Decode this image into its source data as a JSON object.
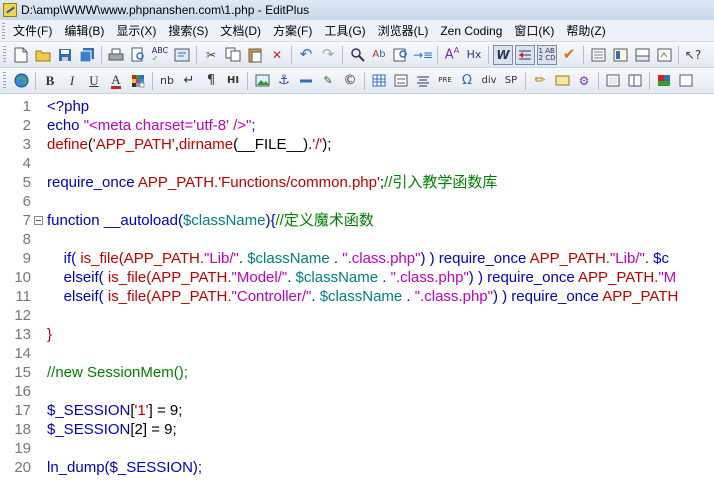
{
  "window": {
    "title": "D:\\amp\\WWW\\www.phpnanshen.com\\1.php - EditPlus"
  },
  "menu": {
    "items": [
      "文件(F)",
      "编辑(B)",
      "显示(X)",
      "搜索(S)",
      "文档(D)",
      "方案(F)",
      "工具(G)",
      "浏览器(L)",
      "Zen Coding",
      "窗口(K)",
      "帮助(Z)"
    ]
  },
  "toolbar2": {
    "bold": "B",
    "italic": "I",
    "underline": "U",
    "fontcolor": "A",
    "nb": "nb",
    "hi": "HI",
    "pre": "PRE",
    "div": "div",
    "sp": "SP",
    "hx": "Hx"
  },
  "editor": {
    "lines": [
      {
        "n": "1",
        "tokens": [
          {
            "t": "<?php",
            "c": "c-blue"
          }
        ]
      },
      {
        "n": "2",
        "tokens": [
          {
            "t": "echo ",
            "c": "c-blue"
          },
          {
            "t": "\"<meta charset='utf-8' />\"",
            "c": "c-str"
          },
          {
            "t": ";",
            "c": "c-blue"
          }
        ]
      },
      {
        "n": "3",
        "tokens": [
          {
            "t": "define",
            "c": "c-red"
          },
          {
            "t": "(",
            "c": "c-black"
          },
          {
            "t": "'APP_PATH'",
            "c": "c-red"
          },
          {
            "t": ",",
            "c": "c-black"
          },
          {
            "t": "dirname",
            "c": "c-red"
          },
          {
            "t": "(__FILE__).",
            "c": "c-black"
          },
          {
            "t": "'/'",
            "c": "c-red"
          },
          {
            "t": ");",
            "c": "c-black"
          }
        ]
      },
      {
        "n": "4",
        "tokens": []
      },
      {
        "n": "5",
        "tokens": [
          {
            "t": "require_once ",
            "c": "c-blue"
          },
          {
            "t": "APP_PATH.",
            "c": "c-red"
          },
          {
            "t": "'Functions/common.php'",
            "c": "c-red"
          },
          {
            "t": ";",
            "c": "c-black"
          },
          {
            "t": "//引入教学函数库",
            "c": "c-cmt"
          }
        ]
      },
      {
        "n": "6",
        "tokens": []
      },
      {
        "n": "7",
        "fold": true,
        "tokens": [
          {
            "t": "function ",
            "c": "c-blue"
          },
          {
            "t": "__autoload(",
            "c": "c-blue"
          },
          {
            "t": "$className",
            "c": "c-var"
          },
          {
            "t": "){",
            "c": "c-blue"
          },
          {
            "t": "//定义魔术函数",
            "c": "c-cmt"
          }
        ]
      },
      {
        "n": "8",
        "tokens": []
      },
      {
        "n": "9",
        "tokens": [
          {
            "t": "    if( ",
            "c": "c-blue"
          },
          {
            "t": "is_file",
            "c": "c-red"
          },
          {
            "t": "(APP_PATH.",
            "c": "c-red"
          },
          {
            "t": "\"Lib/\"",
            "c": "c-str"
          },
          {
            "t": ". ",
            "c": "c-blue"
          },
          {
            "t": "$className",
            "c": "c-var"
          },
          {
            "t": " . ",
            "c": "c-blue"
          },
          {
            "t": "\".class.php\"",
            "c": "c-str"
          },
          {
            "t": ") ) require_once ",
            "c": "c-blue"
          },
          {
            "t": "APP_PATH.",
            "c": "c-red"
          },
          {
            "t": "\"Lib/\"",
            "c": "c-str"
          },
          {
            "t": ". $c",
            "c": "c-blue"
          }
        ]
      },
      {
        "n": "10",
        "tokens": [
          {
            "t": "    elseif( ",
            "c": "c-blue"
          },
          {
            "t": "is_file",
            "c": "c-red"
          },
          {
            "t": "(APP_PATH.",
            "c": "c-red"
          },
          {
            "t": "\"Model/\"",
            "c": "c-str"
          },
          {
            "t": ". ",
            "c": "c-blue"
          },
          {
            "t": "$className",
            "c": "c-var"
          },
          {
            "t": " . ",
            "c": "c-blue"
          },
          {
            "t": "\".class.php\"",
            "c": "c-str"
          },
          {
            "t": ") ) require_once ",
            "c": "c-blue"
          },
          {
            "t": "APP_PATH.",
            "c": "c-red"
          },
          {
            "t": "\"M",
            "c": "c-str"
          }
        ]
      },
      {
        "n": "11",
        "tokens": [
          {
            "t": "    elseif( ",
            "c": "c-blue"
          },
          {
            "t": "is_file",
            "c": "c-red"
          },
          {
            "t": "(APP_PATH.",
            "c": "c-red"
          },
          {
            "t": "\"Controller/\"",
            "c": "c-str"
          },
          {
            "t": ". ",
            "c": "c-blue"
          },
          {
            "t": "$className",
            "c": "c-var"
          },
          {
            "t": " . ",
            "c": "c-blue"
          },
          {
            "t": "\".class.php\"",
            "c": "c-str"
          },
          {
            "t": ") ) require_once ",
            "c": "c-blue"
          },
          {
            "t": "APP_PATH",
            "c": "c-red"
          }
        ]
      },
      {
        "n": "12",
        "tokens": []
      },
      {
        "n": "13",
        "tokens": [
          {
            "t": "}",
            "c": "c-red"
          }
        ]
      },
      {
        "n": "14",
        "tokens": []
      },
      {
        "n": "15",
        "tokens": [
          {
            "t": "//new SessionMem();",
            "c": "c-cmt"
          }
        ]
      },
      {
        "n": "16",
        "tokens": []
      },
      {
        "n": "17",
        "tokens": [
          {
            "t": "$_SESSION",
            "c": "c-blue"
          },
          {
            "t": "[",
            "c": "c-black"
          },
          {
            "t": "'1'",
            "c": "c-red"
          },
          {
            "t": "] = 9;",
            "c": "c-black"
          }
        ]
      },
      {
        "n": "18",
        "tokens": [
          {
            "t": "$_SESSION",
            "c": "c-blue"
          },
          {
            "t": "[2] = 9;",
            "c": "c-black"
          }
        ]
      },
      {
        "n": "19",
        "tokens": []
      },
      {
        "n": "20",
        "tokens": [
          {
            "t": "ln_dump(",
            "c": "c-blue"
          },
          {
            "t": "$_SESSION",
            "c": "c-blue"
          },
          {
            "t": ");",
            "c": "c-blue"
          }
        ]
      }
    ]
  }
}
